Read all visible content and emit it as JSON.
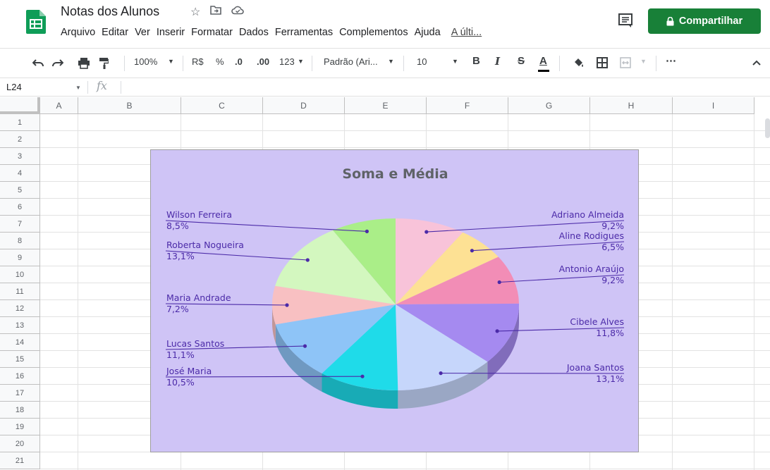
{
  "doc": {
    "title": "Notas dos Alunos",
    "menu": [
      "Arquivo",
      "Editar",
      "Ver",
      "Inserir",
      "Formatar",
      "Dados",
      "Ferramentas",
      "Complementos",
      "Ajuda"
    ],
    "last_edit": "A últi...",
    "share_label": "Compartilhar"
  },
  "toolbar": {
    "zoom": "100%",
    "currency": "R$",
    "percent": "%",
    "decimal_less": ".0",
    "decimal_more": ".00",
    "format_more": "123",
    "font": "Padrão (Ari...",
    "font_size": "10",
    "bold": "B",
    "italic": "I",
    "strike": "S",
    "text_color": "A",
    "more": "⋯"
  },
  "formula_bar": {
    "cell_ref": "L24",
    "fx": "fx"
  },
  "sheet": {
    "columns": [
      "A",
      "B",
      "C",
      "D",
      "E",
      "F",
      "G",
      "H",
      "I"
    ],
    "rows": [
      "1",
      "2",
      "3",
      "4",
      "5",
      "6",
      "7",
      "8",
      "9",
      "10",
      "11",
      "12",
      "13",
      "14",
      "15",
      "16",
      "17",
      "18",
      "19",
      "20",
      "21"
    ]
  },
  "chart_data": {
    "type": "pie",
    "title": "Soma e Média",
    "legend": "labels",
    "slices": [
      {
        "label": "Adriano Almeida",
        "value": 9.2,
        "pct": "9,2%",
        "color": "#f8c3d9"
      },
      {
        "label": "Aline Rodigues",
        "value": 6.5,
        "pct": "6,5%",
        "color": "#fde194"
      },
      {
        "label": "Antonio Araújo",
        "value": 9.2,
        "pct": "9,2%",
        "color": "#f28db6"
      },
      {
        "label": "Cibele Alves",
        "value": 11.8,
        "pct": "11,8%",
        "color": "#a58af0"
      },
      {
        "label": "Joana Santos",
        "value": 13.1,
        "pct": "13,1%",
        "color": "#c6d6fb"
      },
      {
        "label": "José Maria",
        "value": 10.5,
        "pct": "10,5%",
        "color": "#1fdbe9"
      },
      {
        "label": "Lucas Santos",
        "value": 11.1,
        "pct": "11,1%",
        "color": "#8ec4f7"
      },
      {
        "label": "Maria Andrade",
        "value": 7.2,
        "pct": "7,2%",
        "color": "#f8c0c2"
      },
      {
        "label": "Roberta Nogueira",
        "value": 13.1,
        "pct": "13,1%",
        "color": "#d3f7bf"
      },
      {
        "label": "Wilson Ferreira",
        "value": 8.5,
        "pct": "8,5%",
        "color": "#aaee88"
      }
    ],
    "colors": {
      "background": "#cfc4f6",
      "label": "#4b2aa8",
      "title": "#5f6368"
    }
  }
}
